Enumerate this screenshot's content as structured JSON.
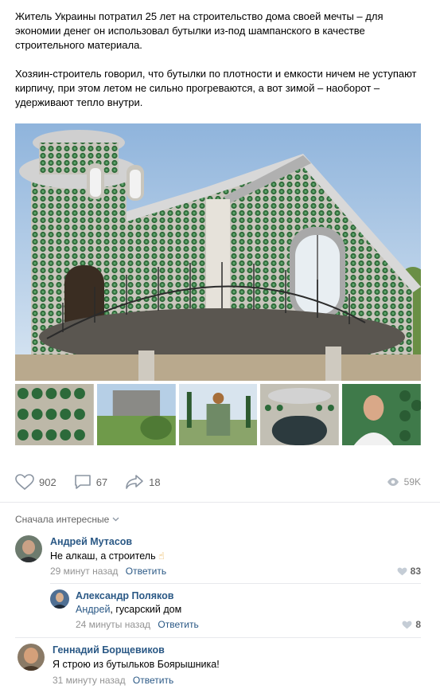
{
  "post": {
    "paragraphs": [
      "Житель Украины потратил 25 лет на строительство дома своей мечты – для экономии денег он использовал бутылки из-под шампанского в качестве строительного материала.",
      "Хозяин-строитель говорил, что бутылки по плотности и емкости ничем не уступают кирпичу, при этом летом не сильно прогреваются, а вот зимой – наоборот – удерживают тепло внутри."
    ]
  },
  "actions": {
    "likes": "902",
    "comments": "67",
    "shares": "18",
    "views": "59K"
  },
  "sort_label": "Сначала интересные",
  "comments": [
    {
      "author": "Андрей Мутасов",
      "text": "Не алкаш, а строитель",
      "emoji": "☝",
      "time": "29 минут назад",
      "reply": "Ответить",
      "likes": "83"
    },
    {
      "author": "Александр Поляков",
      "mention": "Андрей",
      "text": ", гусарский дом",
      "time": "24 минуты назад",
      "reply": "Ответить",
      "likes": "8"
    },
    {
      "author": "Геннадий Борщевиков",
      "text": "Я строю из бутыльков Боярышника!",
      "time": "31 минуту назад",
      "reply": "Ответить"
    }
  ],
  "colors": {
    "link": "#2a5885",
    "muted": "#939393",
    "bottle_green": "#2f6b3a",
    "sky": "#a9c6e6"
  }
}
